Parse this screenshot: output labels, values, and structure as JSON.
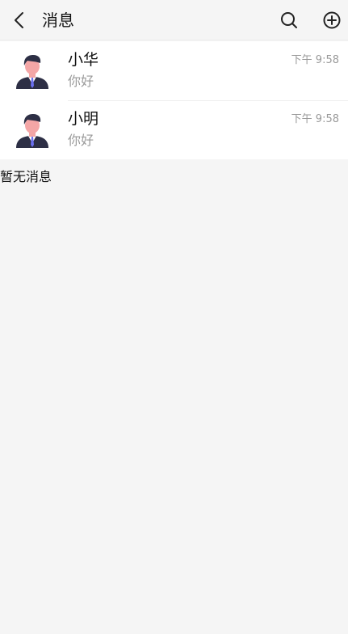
{
  "header": {
    "title": "消息",
    "back_icon": "chevron-left-icon",
    "search_icon": "search-icon",
    "add_icon": "plus-circle-icon"
  },
  "conversations": [
    {
      "name": "小华",
      "preview": "你好",
      "time": "下午 9:58",
      "avatar_icon": "user-avatar-icon"
    },
    {
      "name": "小明",
      "preview": "你好",
      "time": "下午 9:58",
      "avatar_icon": "user-avatar-icon"
    }
  ],
  "empty_text": "暂无消息",
  "colors": {
    "background": "#f5f5f5",
    "list_background": "#ffffff",
    "primary_text": "#111111",
    "secondary_text": "#9a9a9a",
    "avatar_suit": "#2d2f45",
    "avatar_tie": "#6b6ff0",
    "avatar_skin": "#f4a6a6",
    "avatar_hair": "#2d2f45"
  }
}
